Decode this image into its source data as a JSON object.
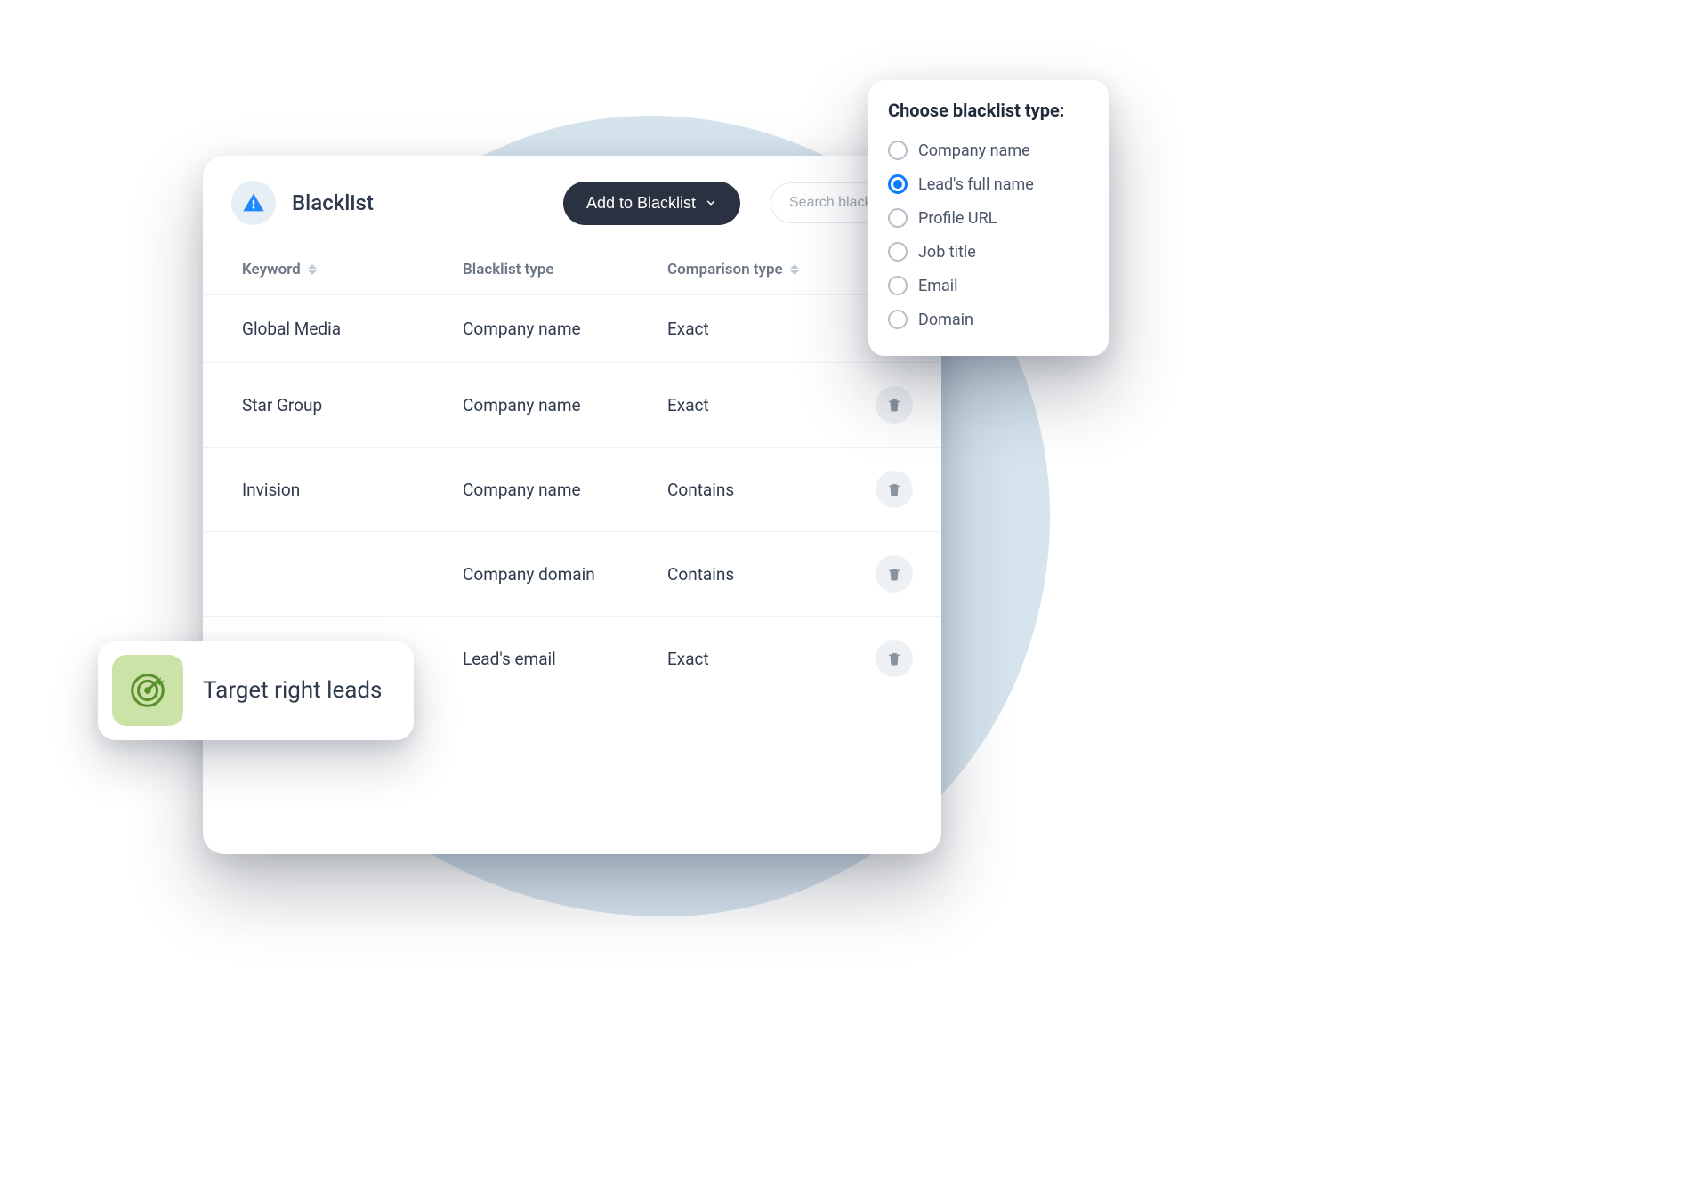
{
  "header": {
    "title": "Blacklist",
    "add_button_label": "Add to Blacklist",
    "search_placeholder": "Search blacklist h"
  },
  "table": {
    "columns": {
      "keyword": "Keyword",
      "type": "Blacklist type",
      "comparison": "Comparison type"
    },
    "rows": [
      {
        "keyword": "Global Media",
        "type": "Company name",
        "comparison": "Exact",
        "show_delete": false
      },
      {
        "keyword": "Star Group",
        "type": "Company name",
        "comparison": "Exact",
        "show_delete": true
      },
      {
        "keyword": "Invision",
        "type": "Company name",
        "comparison": "Contains",
        "show_delete": true
      },
      {
        "keyword": "",
        "type": "Company domain",
        "comparison": "Contains",
        "show_delete": true
      },
      {
        "keyword": "",
        "type": "Lead's email",
        "comparison": "Exact",
        "show_delete": true
      }
    ]
  },
  "target_chip": {
    "label": "Target right leads"
  },
  "dropdown": {
    "title": "Choose blacklist type:",
    "options": [
      {
        "label": "Company name",
        "selected": false
      },
      {
        "label": "Lead's full name",
        "selected": true
      },
      {
        "label": "Profile URL",
        "selected": false
      },
      {
        "label": "Job title",
        "selected": false
      },
      {
        "label": "Email",
        "selected": false
      },
      {
        "label": "Domain",
        "selected": false
      }
    ]
  }
}
